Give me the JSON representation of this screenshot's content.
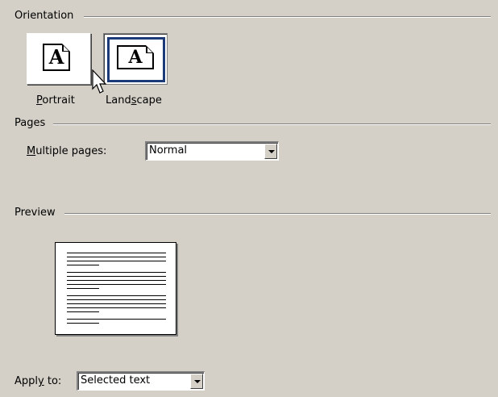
{
  "orientation": {
    "legend": "Orientation",
    "portrait_prefix": "",
    "portrait_mn": "P",
    "portrait_rest": "ortrait",
    "landscape_prefix": "Land",
    "landscape_mn": "s",
    "landscape_rest": "cape",
    "glyph_letter": "A",
    "selected": "Landscape"
  },
  "pages": {
    "legend": "Pages",
    "multiple_label_mn": "M",
    "multiple_label_rest": "ultiple pages:",
    "multiple_value": "Normal"
  },
  "preview": {
    "legend": "Preview"
  },
  "apply": {
    "label_prefix": "Appl",
    "label_mn": "y",
    "label_rest": " to:",
    "value": "Selected text"
  },
  "colors": {
    "dialog_bg": "#d4d0c8",
    "selection_frame": "#1c3a78"
  },
  "icons": {
    "cursor": "mouse-pointer-icon",
    "dropdown": "chevron-down-icon"
  }
}
